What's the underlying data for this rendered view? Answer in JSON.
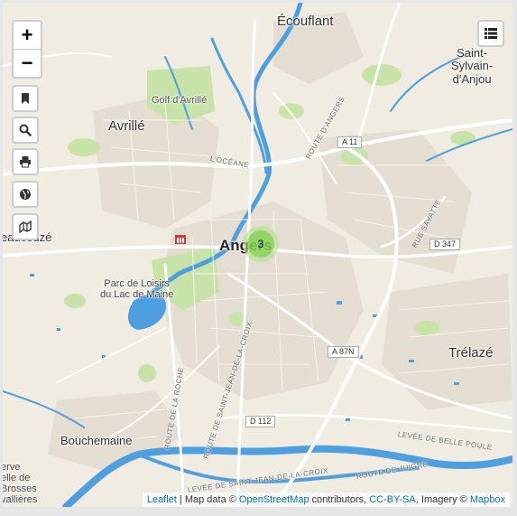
{
  "controls": {
    "zoom_in": "+",
    "zoom_out": "−",
    "buttons": [
      "bookmark-icon",
      "search-icon",
      "print-icon",
      "globe-icon",
      "measure-icon"
    ],
    "layers": "layers-list-icon"
  },
  "cluster": {
    "count": "3",
    "color": "#6ecc39"
  },
  "places": {
    "ecouflant": "Écouflant",
    "saint_sylvain": "Saint-\nSylvain-\nd'Anjou",
    "avrille": "Avrillé",
    "golf": "Golf d'Avrillé",
    "beaucouze": "eaucouzé",
    "angers": "Angers",
    "parc": "Parc de Loisirs\ndu Lac de Maine",
    "trelaze": "Trélazé",
    "bouchemaine": "Bouchemaine",
    "reserve": "erve\nelle de\nBrosses\nvallières"
  },
  "roads": {
    "oceane": "L'OCÉANE",
    "route_angers": "ROUTE D'ANGERS",
    "rue_savatte": "RUE SAVATTE",
    "route_roche": "ROUTE DE LA ROCHE",
    "route_jean": "ROUTE DE SAINT-JEAN-DE-LA-CROIX",
    "levee_belle": "LEVÉE DE BELLE POULE",
    "levee_saint": "LEVÉE DE SAINT-JEAN-DE-LA-CROIX",
    "route_juigne": "ROUTE DE JUIGNÉ"
  },
  "shields": {
    "a11": "A 11",
    "d347": "D 347",
    "a87n": "A 87N",
    "d112": "D 112"
  },
  "attribution": {
    "leaflet": "Leaflet",
    "sep1": " | Map data © ",
    "osm": "OpenStreetMap",
    "sep2": " contributors, ",
    "ccbysa": "CC-BY-SA",
    "sep3": ", Imagery © ",
    "mapbox": "Mapbox"
  },
  "colors": {
    "land": "#f0ece1",
    "water": "#4d9fe0",
    "park": "#c8e3a8",
    "urban": "#e4ddd1",
    "road": "#ffffff"
  }
}
